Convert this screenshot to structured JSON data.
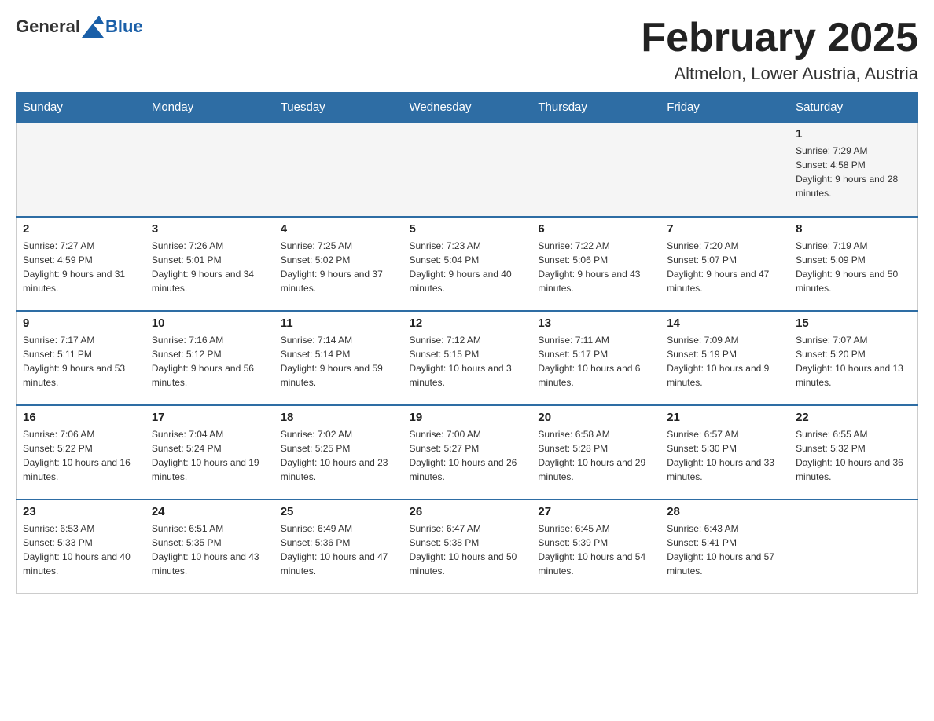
{
  "header": {
    "logo_text_general": "General",
    "logo_text_blue": "Blue",
    "calendar_title": "February 2025",
    "location": "Altmelon, Lower Austria, Austria"
  },
  "weekdays": [
    "Sunday",
    "Monday",
    "Tuesday",
    "Wednesday",
    "Thursday",
    "Friday",
    "Saturday"
  ],
  "weeks": [
    [
      {
        "day": "",
        "sunrise": "",
        "sunset": "",
        "daylight": ""
      },
      {
        "day": "",
        "sunrise": "",
        "sunset": "",
        "daylight": ""
      },
      {
        "day": "",
        "sunrise": "",
        "sunset": "",
        "daylight": ""
      },
      {
        "day": "",
        "sunrise": "",
        "sunset": "",
        "daylight": ""
      },
      {
        "day": "",
        "sunrise": "",
        "sunset": "",
        "daylight": ""
      },
      {
        "day": "",
        "sunrise": "",
        "sunset": "",
        "daylight": ""
      },
      {
        "day": "1",
        "sunrise": "Sunrise: 7:29 AM",
        "sunset": "Sunset: 4:58 PM",
        "daylight": "Daylight: 9 hours and 28 minutes."
      }
    ],
    [
      {
        "day": "2",
        "sunrise": "Sunrise: 7:27 AM",
        "sunset": "Sunset: 4:59 PM",
        "daylight": "Daylight: 9 hours and 31 minutes."
      },
      {
        "day": "3",
        "sunrise": "Sunrise: 7:26 AM",
        "sunset": "Sunset: 5:01 PM",
        "daylight": "Daylight: 9 hours and 34 minutes."
      },
      {
        "day": "4",
        "sunrise": "Sunrise: 7:25 AM",
        "sunset": "Sunset: 5:02 PM",
        "daylight": "Daylight: 9 hours and 37 minutes."
      },
      {
        "day": "5",
        "sunrise": "Sunrise: 7:23 AM",
        "sunset": "Sunset: 5:04 PM",
        "daylight": "Daylight: 9 hours and 40 minutes."
      },
      {
        "day": "6",
        "sunrise": "Sunrise: 7:22 AM",
        "sunset": "Sunset: 5:06 PM",
        "daylight": "Daylight: 9 hours and 43 minutes."
      },
      {
        "day": "7",
        "sunrise": "Sunrise: 7:20 AM",
        "sunset": "Sunset: 5:07 PM",
        "daylight": "Daylight: 9 hours and 47 minutes."
      },
      {
        "day": "8",
        "sunrise": "Sunrise: 7:19 AM",
        "sunset": "Sunset: 5:09 PM",
        "daylight": "Daylight: 9 hours and 50 minutes."
      }
    ],
    [
      {
        "day": "9",
        "sunrise": "Sunrise: 7:17 AM",
        "sunset": "Sunset: 5:11 PM",
        "daylight": "Daylight: 9 hours and 53 minutes."
      },
      {
        "day": "10",
        "sunrise": "Sunrise: 7:16 AM",
        "sunset": "Sunset: 5:12 PM",
        "daylight": "Daylight: 9 hours and 56 minutes."
      },
      {
        "day": "11",
        "sunrise": "Sunrise: 7:14 AM",
        "sunset": "Sunset: 5:14 PM",
        "daylight": "Daylight: 9 hours and 59 minutes."
      },
      {
        "day": "12",
        "sunrise": "Sunrise: 7:12 AM",
        "sunset": "Sunset: 5:15 PM",
        "daylight": "Daylight: 10 hours and 3 minutes."
      },
      {
        "day": "13",
        "sunrise": "Sunrise: 7:11 AM",
        "sunset": "Sunset: 5:17 PM",
        "daylight": "Daylight: 10 hours and 6 minutes."
      },
      {
        "day": "14",
        "sunrise": "Sunrise: 7:09 AM",
        "sunset": "Sunset: 5:19 PM",
        "daylight": "Daylight: 10 hours and 9 minutes."
      },
      {
        "day": "15",
        "sunrise": "Sunrise: 7:07 AM",
        "sunset": "Sunset: 5:20 PM",
        "daylight": "Daylight: 10 hours and 13 minutes."
      }
    ],
    [
      {
        "day": "16",
        "sunrise": "Sunrise: 7:06 AM",
        "sunset": "Sunset: 5:22 PM",
        "daylight": "Daylight: 10 hours and 16 minutes."
      },
      {
        "day": "17",
        "sunrise": "Sunrise: 7:04 AM",
        "sunset": "Sunset: 5:24 PM",
        "daylight": "Daylight: 10 hours and 19 minutes."
      },
      {
        "day": "18",
        "sunrise": "Sunrise: 7:02 AM",
        "sunset": "Sunset: 5:25 PM",
        "daylight": "Daylight: 10 hours and 23 minutes."
      },
      {
        "day": "19",
        "sunrise": "Sunrise: 7:00 AM",
        "sunset": "Sunset: 5:27 PM",
        "daylight": "Daylight: 10 hours and 26 minutes."
      },
      {
        "day": "20",
        "sunrise": "Sunrise: 6:58 AM",
        "sunset": "Sunset: 5:28 PM",
        "daylight": "Daylight: 10 hours and 29 minutes."
      },
      {
        "day": "21",
        "sunrise": "Sunrise: 6:57 AM",
        "sunset": "Sunset: 5:30 PM",
        "daylight": "Daylight: 10 hours and 33 minutes."
      },
      {
        "day": "22",
        "sunrise": "Sunrise: 6:55 AM",
        "sunset": "Sunset: 5:32 PM",
        "daylight": "Daylight: 10 hours and 36 minutes."
      }
    ],
    [
      {
        "day": "23",
        "sunrise": "Sunrise: 6:53 AM",
        "sunset": "Sunset: 5:33 PM",
        "daylight": "Daylight: 10 hours and 40 minutes."
      },
      {
        "day": "24",
        "sunrise": "Sunrise: 6:51 AM",
        "sunset": "Sunset: 5:35 PM",
        "daylight": "Daylight: 10 hours and 43 minutes."
      },
      {
        "day": "25",
        "sunrise": "Sunrise: 6:49 AM",
        "sunset": "Sunset: 5:36 PM",
        "daylight": "Daylight: 10 hours and 47 minutes."
      },
      {
        "day": "26",
        "sunrise": "Sunrise: 6:47 AM",
        "sunset": "Sunset: 5:38 PM",
        "daylight": "Daylight: 10 hours and 50 minutes."
      },
      {
        "day": "27",
        "sunrise": "Sunrise: 6:45 AM",
        "sunset": "Sunset: 5:39 PM",
        "daylight": "Daylight: 10 hours and 54 minutes."
      },
      {
        "day": "28",
        "sunrise": "Sunrise: 6:43 AM",
        "sunset": "Sunset: 5:41 PM",
        "daylight": "Daylight: 10 hours and 57 minutes."
      },
      {
        "day": "",
        "sunrise": "",
        "sunset": "",
        "daylight": ""
      }
    ]
  ]
}
